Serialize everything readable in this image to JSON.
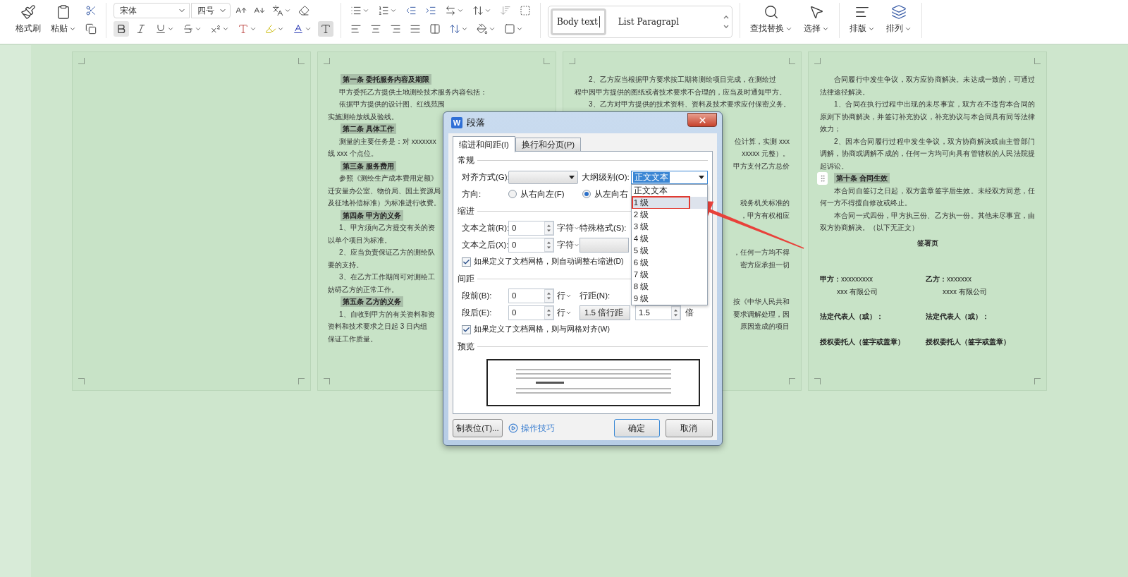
{
  "toolbar": {
    "clipboard": [
      {
        "label": "格式刷",
        "caret": false
      },
      {
        "label": "粘贴",
        "caret": true
      }
    ],
    "font": {
      "family": "宋体",
      "size": "四号"
    },
    "styles": [
      {
        "label": "Body text",
        "selected": true
      },
      {
        "label": "List Paragrapl",
        "selected": false
      }
    ],
    "tools": [
      {
        "label": "查找替换",
        "caret": true
      },
      {
        "label": "选择",
        "caret": true
      },
      {
        "label": "排版",
        "caret": true
      },
      {
        "label": "排列",
        "caret": true
      }
    ]
  },
  "pages": [
    {
      "kind": "blank"
    },
    {
      "kind": "lines",
      "lines": [
        {
          "text": "第一条 委托服务内容及期限",
          "kind": "heading"
        },
        {
          "text": "甲方委托乙方提供土地测绘技术服务内容包括：",
          "kind": "indent"
        },
        {
          "text": "依据甲方提供的设计图、红线范围",
          "kind": "indent"
        },
        {
          "text": "实施测绘放线及验线。",
          "kind": "plain"
        },
        {
          "text": "第二条 具体工作",
          "kind": "heading"
        },
        {
          "text": "测量的主要任务是：对 xxxxxxx",
          "kind": "indent"
        },
        {
          "text": "线 xxx 个点位。",
          "kind": "plain"
        },
        {
          "text": "第三条 服务费用",
          "kind": "heading"
        },
        {
          "text": "参照《测绘生产成本费用定额》",
          "kind": "indent"
        },
        {
          "text": "迁安量办公室、物价局、国土资源局",
          "kind": "plain"
        },
        {
          "text": "及征地补偿标准）为标准进行收费。",
          "kind": "plain"
        },
        {
          "text": "第四条 甲方的义务",
          "kind": "heading"
        },
        {
          "text": "1、甲方须向乙方提交有关的资",
          "kind": "indent"
        },
        {
          "text": "以单个项目为标准。",
          "kind": "plain"
        },
        {
          "text": "2、应当负责保证乙方的测绘队",
          "kind": "indent"
        },
        {
          "text": "要的支持。",
          "kind": "plain"
        },
        {
          "text": "3、在乙方工作期间可对测绘工",
          "kind": "indent"
        },
        {
          "text": "妨碍乙方的正常工作。",
          "kind": "plain"
        },
        {
          "text": "第五条 乙方的义务",
          "kind": "heading"
        },
        {
          "text": "1、自收到甲方的有关资料和资",
          "kind": "indent"
        },
        {
          "text": "资料和技术要求之日起 3 日内组",
          "kind": "plain"
        },
        {
          "text": "保证工作质量。",
          "kind": "plain"
        }
      ]
    },
    {
      "kind": "fragments",
      "top": [
        {
          "text": "2、乙方应当根据甲方要求按工期将测绘项目完成，在测绘过",
          "kind": "indent"
        },
        {
          "text": "程中因甲方提供的图纸或者技术要求不合理的，应当及时通知甲方。",
          "kind": "plain"
        },
        {
          "text": "3、乙方对甲方提供的技术资料、资料及技术要求应付保密义务。",
          "kind": "indent"
        }
      ],
      "blocks": [
        [
          "位计算，实测 xxx",
          "xxxxx 元整）。",
          "甲方支付乙方总价"
        ],
        [
          "税务机关标准的",
          "，甲方有权相应"
        ],
        [
          "，任何一方均不得",
          "密方应承担一切"
        ],
        [
          "按《中华人民共和",
          "要求调解处理，因",
          "原因造成的项目"
        ]
      ]
    },
    {
      "kind": "paragraphs",
      "paragraphs": [
        {
          "text": "合同履行中发生争议，双方应协商解决。未达成一致的，可通过法律途径解决。",
          "kind": "body"
        },
        {
          "text": "1、合同在执行过程中出现的未尽事宜，双方在不违背本合同的原则下协商解决，并签订补充协议，补充协议与本合同具有同等法律效力；",
          "kind": "body"
        },
        {
          "text": "2、因本合同履行过程中发生争议，双方协商解决或由主管部门调解，协商或调解不成的，任何一方均可向具有管辖权的人民法院提起诉讼。",
          "kind": "body"
        },
        {
          "text": "第十条 合同生效",
          "kind": "heading"
        },
        {
          "text": "本合同自签订之日起，双方盖章签字后生效。未经双方同意，任何一方不得擅自修改或终止。",
          "kind": "body"
        },
        {
          "text": "本合同一式四份，甲方执三份、乙方执一份。其他未尽事宜，由双方协商解决。（以下无正文）",
          "kind": "body"
        },
        {
          "text": "签署页",
          "kind": "title"
        }
      ],
      "signatures": [
        {
          "kind": "party",
          "left": "**甲方：**xxxxxxxxx",
          "right": "**乙方：**xxxxxxx"
        },
        {
          "kind": "company",
          "left": "xxx 有限公司",
          "right": "xxxx 有限公司"
        },
        {
          "kind": "sign",
          "left": "法定代表人（或）：",
          "right": "法定代表人（或）："
        },
        {
          "kind": "sign",
          "left": "授权委托人（签字或盖章）",
          "right": "授权委托人（签字或盖章）"
        }
      ]
    }
  ],
  "dialog": {
    "badge": "W",
    "title": "段落",
    "tabs": [
      {
        "label": "缩进和间距(I)",
        "selected": true
      },
      {
        "label": "换行和分页(P)",
        "selected": false
      }
    ],
    "general": {
      "heading": "常规",
      "alignment_label": "对齐方式(G):",
      "outline_label": "大纲级别(O):",
      "outline_value": "正文文本",
      "direction_label": "方向:",
      "directions": [
        {
          "label": "从右向左(F)",
          "selected": false
        },
        {
          "label": "从左向右",
          "selected": true
        }
      ]
    },
    "outline_options": [
      {
        "label": "正文文本",
        "selected": false
      },
      {
        "label": "1 级",
        "selected": true
      },
      {
        "label": "2 级",
        "selected": false
      },
      {
        "label": "3 级",
        "selected": false
      },
      {
        "label": "4 级",
        "selected": false
      },
      {
        "label": "5 级",
        "selected": false
      },
      {
        "label": "6 级",
        "selected": false
      },
      {
        "label": "7 级",
        "selected": false
      },
      {
        "label": "8 级",
        "selected": false
      },
      {
        "label": "9 级",
        "selected": false
      }
    ],
    "indent": {
      "heading": "缩进",
      "before_label": "文本之前(R):",
      "before_value": "0",
      "before_unit": "字符",
      "after_label": "文本之后(X):",
      "after_value": "0",
      "after_unit": "字符",
      "special_label": "特殊格式(S):",
      "auto_adjust": {
        "label": "如果定义了文档网格，则自动调整右缩进(D)",
        "checked": true
      }
    },
    "spacing": {
      "heading": "间距",
      "before_label": "段前(B):",
      "before_value": "0",
      "before_unit": "行",
      "after_label": "段后(E):",
      "after_value": "0",
      "after_unit": "行",
      "line_label": "行距(N):",
      "line_value": "1.5 倍行距",
      "at_value": "1.5",
      "at_unit": "倍",
      "snap": {
        "label": "如果定义了文档网格，则与网格对齐(W)",
        "checked": true
      }
    },
    "preview": {
      "heading": "预览"
    },
    "tabstops_button": "制表位(T)...",
    "tips_link": "操作技巧",
    "ok_button": "确定",
    "cancel_button": "取消"
  }
}
